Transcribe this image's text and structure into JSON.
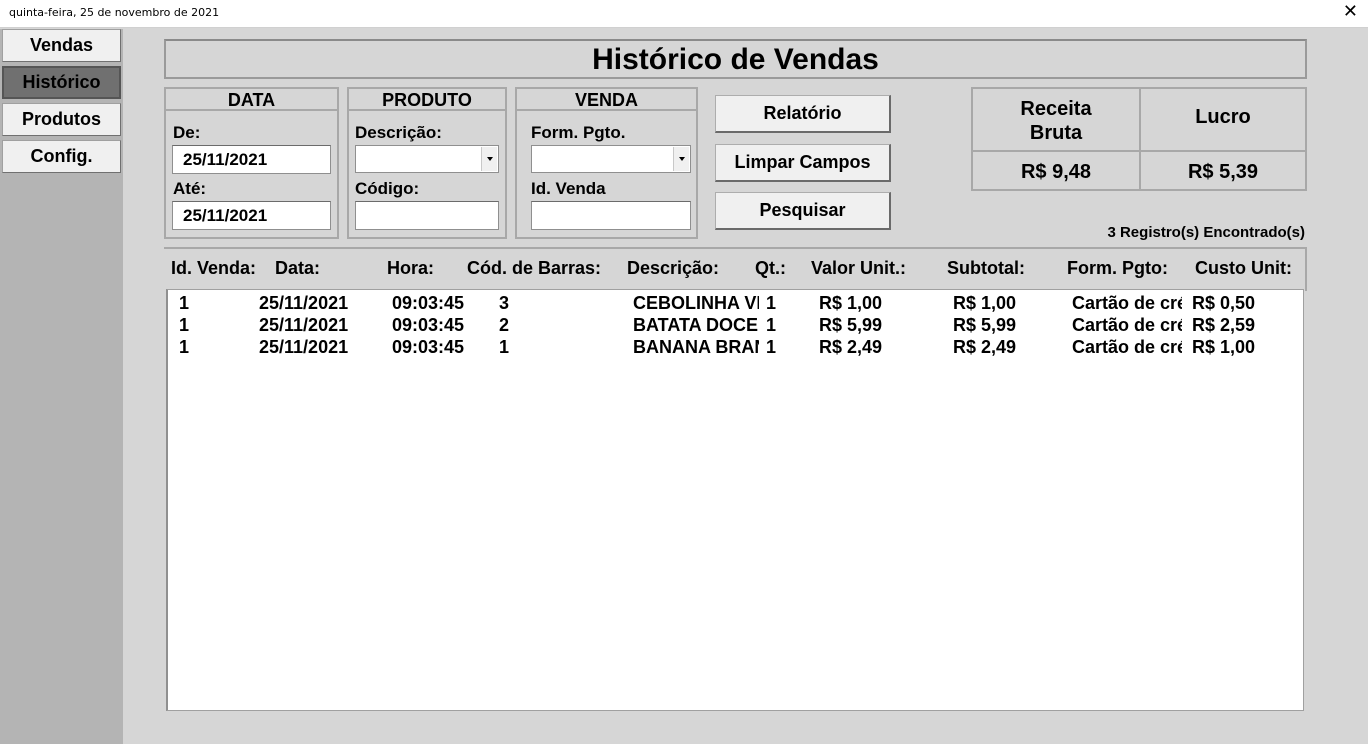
{
  "titlebar": {
    "date": "quinta-feira, 25 de novembro de 2021",
    "close": "✕"
  },
  "nav": [
    {
      "label": "Vendas"
    },
    {
      "label": "Histórico"
    },
    {
      "label": "Produtos"
    },
    {
      "label": "Config."
    }
  ],
  "header": {
    "title": "Histórico de Vendas"
  },
  "data_group": {
    "title": "DATA",
    "from_label": "De:",
    "from_value": "25/11/2021",
    "to_label": "Até:",
    "to_value": "25/11/2021"
  },
  "produto_group": {
    "title": "PRODUTO",
    "desc_label": "Descrição:",
    "desc_value": "",
    "code_label": "Código:",
    "code_value": ""
  },
  "venda_group": {
    "title": "VENDA",
    "pay_label": "Form. Pgto.",
    "pay_value": "",
    "id_label": "Id. Venda",
    "id_value": ""
  },
  "actions": {
    "report": "Relatório",
    "clear": "Limpar Campos",
    "search": "Pesquisar"
  },
  "summary": {
    "gross_label": "Receita\nBruta",
    "gross_value": "R$ 9,48",
    "profit_label": "Lucro",
    "profit_value": "R$ 5,39"
  },
  "records_found": "3 Registro(s) Encontrado(s)",
  "columns": [
    "Id. Venda:",
    "Data:",
    "Hora:",
    "Cód. de Barras:",
    "Descrição:",
    "Qt.:",
    "Valor Unit.:",
    "Subtotal:",
    "Form. Pgto:",
    "Custo Unit:"
  ],
  "rows": [
    [
      "1",
      "25/11/2021",
      "09:03:45",
      "3",
      "CEBOLINHA VERDE",
      "1",
      "R$ 1,00",
      "R$ 1,00",
      "Cartão de crédito",
      "R$ 0,50"
    ],
    [
      "1",
      "25/11/2021",
      "09:03:45",
      "2",
      "BATATA DOCE",
      "1",
      "R$ 5,99",
      "R$ 5,99",
      "Cartão de crédito",
      "R$ 2,59"
    ],
    [
      "1",
      "25/11/2021",
      "09:03:45",
      "1",
      "BANANA BRANCA",
      "1",
      "R$ 2,49",
      "R$ 2,49",
      "Cartão de crédito",
      "R$ 1,00"
    ]
  ]
}
